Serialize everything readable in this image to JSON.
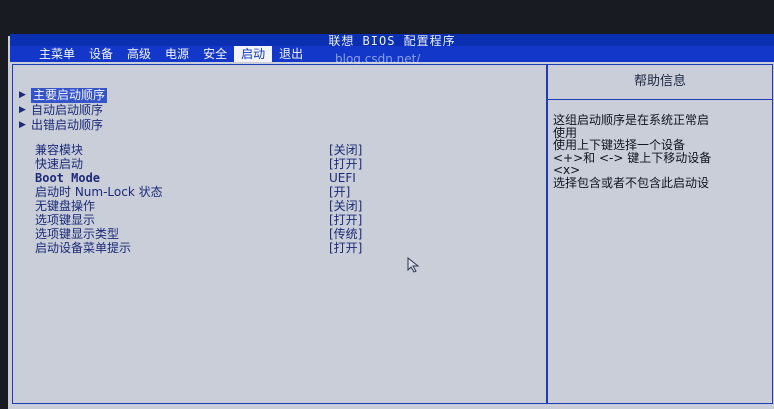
{
  "title": "联想 BIOS 配置程序",
  "menu": [
    "主菜单",
    "设备",
    "高级",
    "电源",
    "安全",
    "启动",
    "退出"
  ],
  "menu_active": "启动",
  "watermark": "blog.csdn.net/",
  "boot_lists": [
    {
      "label": "主要启动顺序",
      "selected": true
    },
    {
      "label": "自动启动顺序",
      "selected": false
    },
    {
      "label": "出错启动顺序",
      "selected": false
    }
  ],
  "settings": [
    {
      "label": "兼容模块",
      "value": "[关闭]"
    },
    {
      "label": "快速启动",
      "value": "[打开]"
    },
    {
      "label": "Boot Mode",
      "value": "UEFI"
    },
    {
      "label": "启动时 Num-Lock 状态",
      "value": "[开]"
    },
    {
      "label": "无键盘操作",
      "value": "[关闭]"
    },
    {
      "label": "选项键显示",
      "value": "[打开]"
    },
    {
      "label": "选项键显示类型",
      "value": "[传统]"
    },
    {
      "label": "启动设备菜单提示",
      "value": "[打开]"
    }
  ],
  "help": {
    "title": "帮助信息",
    "lines": [
      "这组启动顺序是在系统正常启",
      "使用",
      "使用上下键选择一个设备",
      "<+>和 <-> 键上下移动设备",
      "<x>",
      "选择包含或者不包含此启动设"
    ]
  },
  "colors": {
    "menu_bar": "#1338c9",
    "title_bar": "#0a2fb0",
    "panel_bg": "#c9ced8",
    "text": "#1c2a78"
  }
}
